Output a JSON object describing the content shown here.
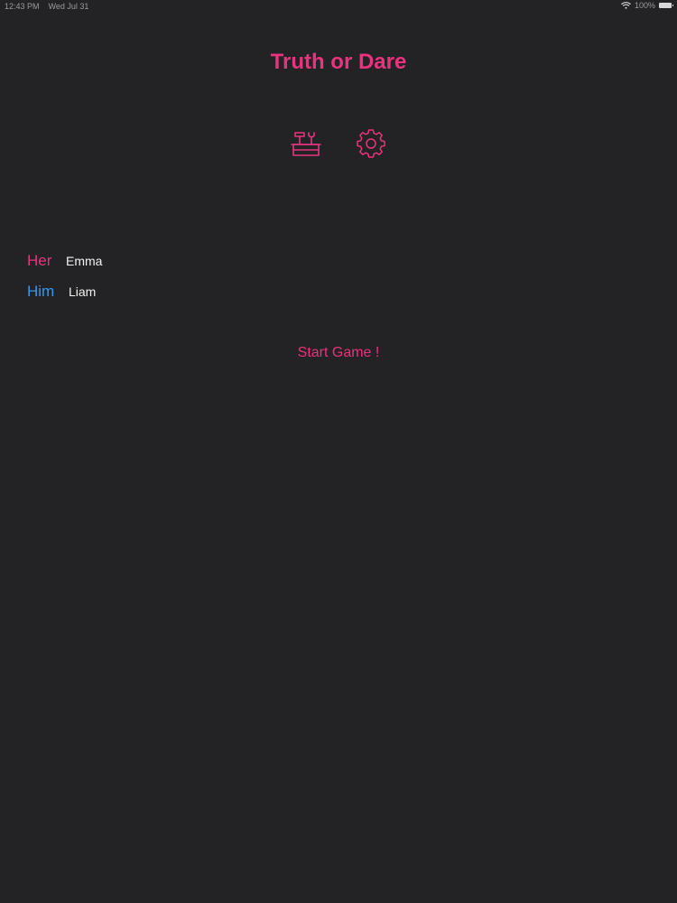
{
  "status_bar": {
    "time": "12:43 PM",
    "date": "Wed Jul 31",
    "battery": "100%"
  },
  "app": {
    "title": "Truth or Dare"
  },
  "toolbar": {
    "toolbox_icon": "toolbox-icon",
    "settings_icon": "gear-icon"
  },
  "players": {
    "her": {
      "label": "Her",
      "name": "Emma"
    },
    "him": {
      "label": "Him",
      "name": "Liam"
    }
  },
  "actions": {
    "start_label": "Start Game !"
  },
  "colors": {
    "background": "#232224",
    "accent_pink": "#e8347e",
    "accent_blue": "#3a97e8"
  }
}
